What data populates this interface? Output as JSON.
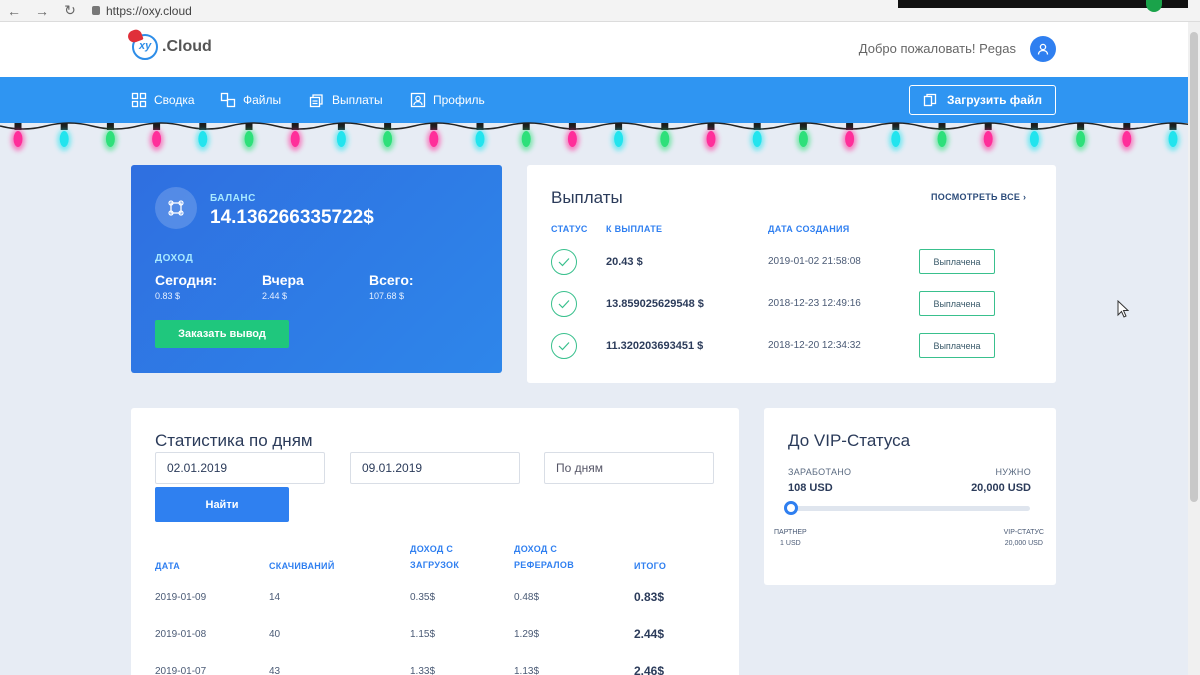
{
  "browser": {
    "url": "https://oxy.cloud",
    "back": "←",
    "forward": "→",
    "reload": "↻"
  },
  "header": {
    "logo_mark": "xy",
    "logo_text": ".Cloud",
    "welcome": "Добро пожаловать! Pegas"
  },
  "nav": {
    "items": [
      {
        "label": "Сводка",
        "icon": "dashboard-icon"
      },
      {
        "label": "Файлы",
        "icon": "files-icon"
      },
      {
        "label": "Выплаты",
        "icon": "payouts-icon"
      },
      {
        "label": "Профиль",
        "icon": "profile-icon"
      }
    ],
    "upload_label": "Загрузить файл"
  },
  "balance": {
    "label": "БАЛАНС",
    "value": "14.136266335722$",
    "income_label": "ДОХОД",
    "today_title": "Сегодня:",
    "today_value": "0.83 $",
    "yesterday_title": "Вчера",
    "yesterday_value": "2.44 $",
    "total_title": "Всего:",
    "total_value": "107.68 $",
    "withdraw_label": "Заказать вывод"
  },
  "payouts": {
    "title": "Выплаты",
    "see_all": "ПОСМОТРЕТЬ ВСЕ  ›",
    "headers": {
      "status": "СТАТУС",
      "amount": "К ВЫПЛАТЕ",
      "date": "ДАТА СОЗДАНИЯ"
    },
    "rows": [
      {
        "amount": "20.43 $",
        "date": "2019-01-02 21:58:08",
        "status": "Выплачена"
      },
      {
        "amount": "13.859025629548 $",
        "date": "2018-12-23 12:49:16",
        "status": "Выплачена"
      },
      {
        "amount": "11.320203693451 $",
        "date": "2018-12-20 12:34:32",
        "status": "Выплачена"
      }
    ]
  },
  "stats": {
    "title": "Статистика по дням",
    "date_from": "02.01.2019",
    "date_to": "09.01.2019",
    "grouping": "По дням",
    "find_label": "Найти",
    "headers": {
      "date": "ДАТА",
      "downloads": "СКАЧИВАНИЙ",
      "download_income_1": "ДОХОД С",
      "download_income_2": "ЗАГРУЗОК",
      "referral_income_1": "ДОХОД С",
      "referral_income_2": "РЕФЕРАЛОВ",
      "total": "ИТОГО"
    },
    "rows": [
      {
        "date": "2019-01-09",
        "downloads": "14",
        "dl_income": "0.35$",
        "ref_income": "0.48$",
        "total": "0.83$"
      },
      {
        "date": "2019-01-08",
        "downloads": "40",
        "dl_income": "1.15$",
        "ref_income": "1.29$",
        "total": "2.44$"
      },
      {
        "date": "2019-01-07",
        "downloads": "43",
        "dl_income": "1.33$",
        "ref_income": "1.13$",
        "total": "2.46$"
      }
    ]
  },
  "vip": {
    "title": "До VIP-Статуса",
    "earned_label": "ЗАРАБОТАНО",
    "earned_value": "108 USD",
    "needed_label": "НУЖНО",
    "needed_value": "20,000 USD",
    "progress": 0.0054,
    "start_label": "ПАРТНЕР",
    "start_value": "1 USD",
    "end_label": "VIP-СТАТУС",
    "end_value": "20,000 USD"
  },
  "colors": {
    "nav": "#2f95f2",
    "accent": "#2f7ff0",
    "success": "#1fc77d",
    "background": "#e7ecf4"
  }
}
